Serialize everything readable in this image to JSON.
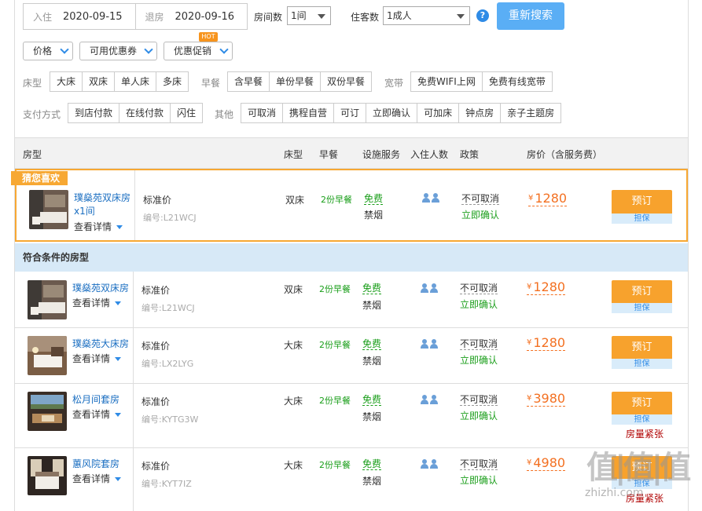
{
  "search": {
    "checkin_label": "入住",
    "checkin_date": "2020-09-15",
    "checkout_label": "退房",
    "checkout_date": "2020-09-16",
    "rooms_label": "房间数",
    "rooms_value": "1间",
    "guests_label": "住客数",
    "guests_value": "1成人",
    "help": "?",
    "search_button": "重新搜索"
  },
  "dropdowns": [
    {
      "label": "价格"
    },
    {
      "label": "可用优惠券"
    },
    {
      "label": "优惠促销",
      "badge": "HOT"
    }
  ],
  "filters": {
    "bed_label": "床型",
    "bed_options": [
      "大床",
      "双床",
      "单人床",
      "多床"
    ],
    "breakfast_label": "早餐",
    "breakfast_options": [
      "含早餐",
      "单份早餐",
      "双份早餐"
    ],
    "broadband_label": "宽带",
    "broadband_options": [
      "免费WIFI上网",
      "免费有线宽带"
    ],
    "payment_label": "支付方式",
    "payment_options": [
      "到店付款",
      "在线付款",
      "闪住"
    ],
    "other_label": "其他",
    "other_options": [
      "可取消",
      "携程自营",
      "可订",
      "立即确认",
      "可加床",
      "钟点房",
      "亲子主题房"
    ]
  },
  "table_header": {
    "room_type": "房型",
    "bed": "床型",
    "breakfast": "早餐",
    "facilities": "设施服务",
    "occupancy": "入住人数",
    "policy": "政策",
    "price": "房价（含服务费）"
  },
  "favorite_tag": "猜您喜欢",
  "section_title": "符合条件的房型",
  "favorite": {
    "name": "璞燊苑双床房x1间",
    "details": "查看详情",
    "plan": "标准价",
    "code": "编号:L21WCJ",
    "bed": "双床",
    "breakfast": "2份早餐",
    "free": "免费",
    "smoking": "禁烟",
    "cancel": "不可取消",
    "confirm": "立即确认",
    "currency": "¥",
    "price": "1280",
    "book": "预订",
    "guarantee": "担保"
  },
  "rooms": [
    {
      "name": "璞燊苑双床房",
      "details": "查看详情",
      "plan": "标准价",
      "code": "编号:L21WCJ",
      "bed": "双床",
      "breakfast": "2份早餐",
      "free": "免费",
      "smoking": "禁烟",
      "cancel": "不可取消",
      "confirm": "立即确认",
      "currency": "¥",
      "price": "1280",
      "book": "预订",
      "guarantee": "担保",
      "scarce": ""
    },
    {
      "name": "璞燊苑大床房",
      "details": "查看详情",
      "plan": "标准价",
      "code": "编号:LX2LYG",
      "bed": "大床",
      "breakfast": "2份早餐",
      "free": "免费",
      "smoking": "禁烟",
      "cancel": "不可取消",
      "confirm": "立即确认",
      "currency": "¥",
      "price": "1280",
      "book": "预订",
      "guarantee": "担保",
      "scarce": ""
    },
    {
      "name": "松月间套房",
      "details": "查看详情",
      "plan": "标准价",
      "code": "编号:KYTG3W",
      "bed": "大床",
      "breakfast": "2份早餐",
      "free": "免费",
      "smoking": "禁烟",
      "cancel": "不可取消",
      "confirm": "立即确认",
      "currency": "¥",
      "price": "3980",
      "book": "预订",
      "guarantee": "担保",
      "scarce": "房量紧张"
    },
    {
      "name": "蕙风院套房",
      "details": "查看详情",
      "plan": "标准价",
      "code": "编号:KYT7IZ",
      "bed": "大床",
      "breakfast": "2份早餐",
      "free": "免费",
      "smoking": "禁烟",
      "cancel": "不可取消",
      "confirm": "立即确认",
      "currency": "¥",
      "price": "4980",
      "book": "预订",
      "guarantee": "担保",
      "scarce": "房量紧张"
    }
  ],
  "watermark": {
    "logo": "值|值|值",
    "text": "zhizhi.com"
  },
  "colors": {
    "accent": "#2f8be6",
    "orange": "#f7a22d",
    "price": "#f37021",
    "green": "#1a9e1a",
    "section_bg": "#d7e9f7"
  }
}
